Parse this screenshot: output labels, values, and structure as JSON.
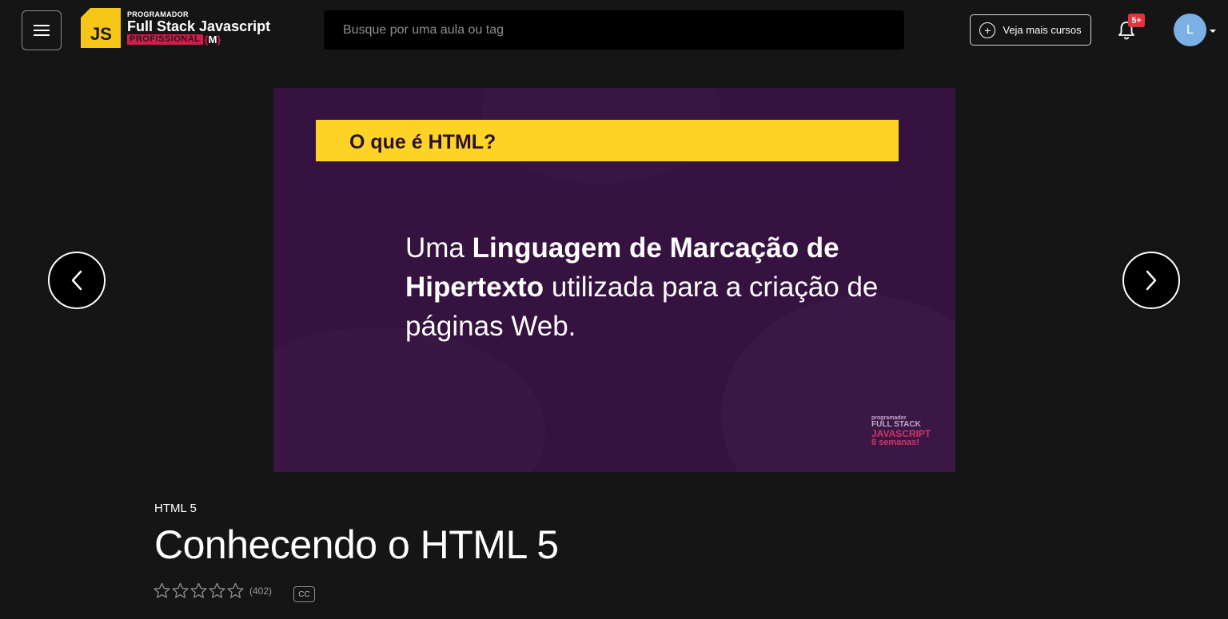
{
  "header": {
    "menu_icon": "hamburger-icon",
    "logo": {
      "badge": "JS",
      "small": "PROGRAMADOR",
      "big": "Full Stack Javascript",
      "tag": "PROFISSIONAL",
      "brace_left": "{",
      "brace_mid": "M",
      "brace_right": "}"
    },
    "search": {
      "placeholder": "Busque por uma aula ou tag",
      "value": ""
    },
    "more_courses_label": "Veja mais cursos",
    "notifications_badge": "5+",
    "avatar_initial": "L"
  },
  "slide": {
    "banner": "O que é HTML?",
    "text": {
      "part1": "Uma ",
      "bold1": "Linguagem de Marcação de Hipertexto",
      "part2": " utilizada para a criação de páginas Web."
    },
    "watermark": {
      "line1": "programador",
      "line2": "FULL STACK",
      "line3": "JAVASCRIPT",
      "line4": "8 semanas!"
    }
  },
  "lesson": {
    "course": "HTML 5",
    "title": "Conhecendo o HTML 5",
    "rating_count": "(402)",
    "stars_filled": 0,
    "stars_total": 5,
    "cc_label": "CC"
  },
  "colors": {
    "background": "#151515",
    "slide_bg": "#35123f",
    "banner": "#fdd426",
    "accent_red": "#d61a4c",
    "avatar": "#7ab0e3"
  }
}
